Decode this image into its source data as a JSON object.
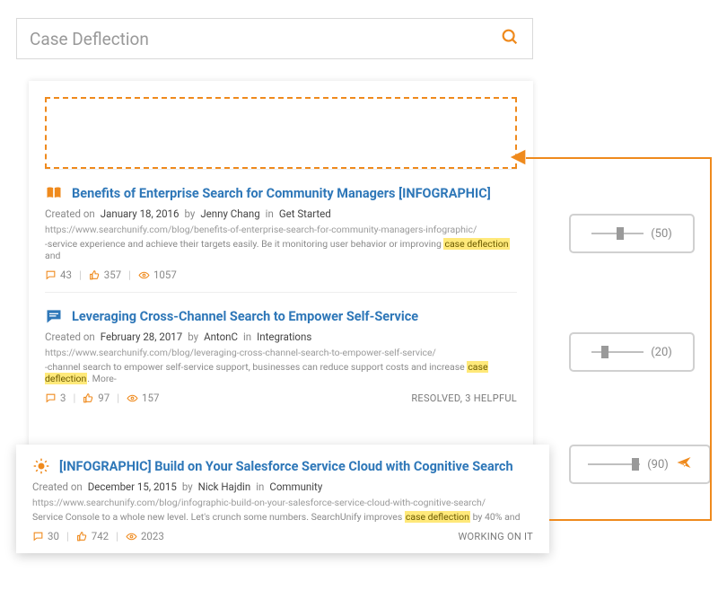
{
  "search": {
    "query": "Case Deflection"
  },
  "results": [
    {
      "icon": "book",
      "title": "Benefits of Enterprise Search for Community Managers [INFOGRAPHIC]",
      "created_label": "Created on",
      "date": "January 18, 2016",
      "by_label": "by",
      "author": "Jenny Chang",
      "in_label": "in",
      "category": "Get Started",
      "url": "https://www.searchunify.com/blog/benefits-of-enterprise-search-for-community-managers-infographic/",
      "snippet_a": "-service experience and achieve their targets easily. Be it monitoring user behavior or improving ",
      "highlight": "case deflection",
      "snippet_b": " and",
      "comments": "43",
      "likes": "357",
      "views": "1057",
      "status": ""
    },
    {
      "icon": "chat",
      "title": "Leveraging Cross-Channel Search to Empower Self-Service",
      "created_label": "Created on",
      "date": "February 28, 2017",
      "by_label": "by",
      "author": "AntonC",
      "in_label": "in",
      "category": "Integrations",
      "url": "https://www.searchunify.com/blog/leveraging-cross-channel-search-to-empower-self-service/",
      "snippet_a": "-channel search to empower self-service support, businesses can reduce support costs and increase ",
      "highlight": "case deflection",
      "snippet_b": ". More-",
      "comments": "3",
      "likes": "97",
      "views": "157",
      "status": "RESOLVED, 3 HELPFUL"
    }
  ],
  "lifted": {
    "icon": "bulb",
    "title": "[INFOGRAPHIC] Build on Your Salesforce Service Cloud with Cognitive Search",
    "created_label": "Created on",
    "date": "December 15, 2015",
    "by_label": "by",
    "author": "Nick Hajdin",
    "in_label": "in",
    "category": "Community",
    "url": "https://www.searchunify.com/blog/infographic-build-on-your-salesforce-service-cloud-with-cognitive-search/",
    "snippet_a": " Service Console to a whole new level. Let's crunch some numbers. SearchUnify improves ",
    "highlight": "case deflection",
    "snippet_b": " by 40% and",
    "comments": "30",
    "likes": "742",
    "views": "2023",
    "status": "WORKING ON IT"
  },
  "sliders": [
    {
      "value": "(50)",
      "pos": 50,
      "boost": false
    },
    {
      "value": "(20)",
      "pos": 20,
      "boost": false
    },
    {
      "value": "(90)",
      "pos": 90,
      "boost": true
    }
  ]
}
